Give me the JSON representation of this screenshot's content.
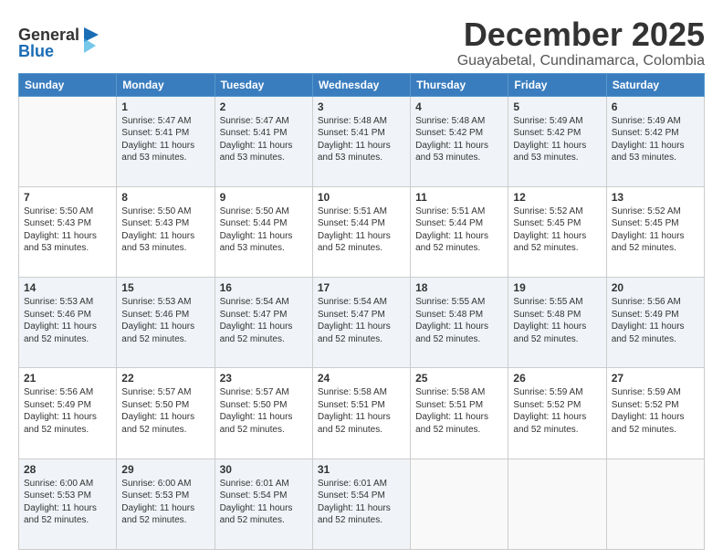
{
  "logo": {
    "line1": "General",
    "line2": "Blue"
  },
  "title": "December 2025",
  "location": "Guayabetal, Cundinamarca, Colombia",
  "headers": [
    "Sunday",
    "Monday",
    "Tuesday",
    "Wednesday",
    "Thursday",
    "Friday",
    "Saturday"
  ],
  "weeks": [
    [
      {
        "day": "",
        "info": ""
      },
      {
        "day": "1",
        "info": "Sunrise: 5:47 AM\nSunset: 5:41 PM\nDaylight: 11 hours\nand 53 minutes."
      },
      {
        "day": "2",
        "info": "Sunrise: 5:47 AM\nSunset: 5:41 PM\nDaylight: 11 hours\nand 53 minutes."
      },
      {
        "day": "3",
        "info": "Sunrise: 5:48 AM\nSunset: 5:41 PM\nDaylight: 11 hours\nand 53 minutes."
      },
      {
        "day": "4",
        "info": "Sunrise: 5:48 AM\nSunset: 5:42 PM\nDaylight: 11 hours\nand 53 minutes."
      },
      {
        "day": "5",
        "info": "Sunrise: 5:49 AM\nSunset: 5:42 PM\nDaylight: 11 hours\nand 53 minutes."
      },
      {
        "day": "6",
        "info": "Sunrise: 5:49 AM\nSunset: 5:42 PM\nDaylight: 11 hours\nand 53 minutes."
      }
    ],
    [
      {
        "day": "7",
        "info": "Sunrise: 5:50 AM\nSunset: 5:43 PM\nDaylight: 11 hours\nand 53 minutes."
      },
      {
        "day": "8",
        "info": "Sunrise: 5:50 AM\nSunset: 5:43 PM\nDaylight: 11 hours\nand 53 minutes."
      },
      {
        "day": "9",
        "info": "Sunrise: 5:50 AM\nSunset: 5:44 PM\nDaylight: 11 hours\nand 53 minutes."
      },
      {
        "day": "10",
        "info": "Sunrise: 5:51 AM\nSunset: 5:44 PM\nDaylight: 11 hours\nand 52 minutes."
      },
      {
        "day": "11",
        "info": "Sunrise: 5:51 AM\nSunset: 5:44 PM\nDaylight: 11 hours\nand 52 minutes."
      },
      {
        "day": "12",
        "info": "Sunrise: 5:52 AM\nSunset: 5:45 PM\nDaylight: 11 hours\nand 52 minutes."
      },
      {
        "day": "13",
        "info": "Sunrise: 5:52 AM\nSunset: 5:45 PM\nDaylight: 11 hours\nand 52 minutes."
      }
    ],
    [
      {
        "day": "14",
        "info": "Sunrise: 5:53 AM\nSunset: 5:46 PM\nDaylight: 11 hours\nand 52 minutes."
      },
      {
        "day": "15",
        "info": "Sunrise: 5:53 AM\nSunset: 5:46 PM\nDaylight: 11 hours\nand 52 minutes."
      },
      {
        "day": "16",
        "info": "Sunrise: 5:54 AM\nSunset: 5:47 PM\nDaylight: 11 hours\nand 52 minutes."
      },
      {
        "day": "17",
        "info": "Sunrise: 5:54 AM\nSunset: 5:47 PM\nDaylight: 11 hours\nand 52 minutes."
      },
      {
        "day": "18",
        "info": "Sunrise: 5:55 AM\nSunset: 5:48 PM\nDaylight: 11 hours\nand 52 minutes."
      },
      {
        "day": "19",
        "info": "Sunrise: 5:55 AM\nSunset: 5:48 PM\nDaylight: 11 hours\nand 52 minutes."
      },
      {
        "day": "20",
        "info": "Sunrise: 5:56 AM\nSunset: 5:49 PM\nDaylight: 11 hours\nand 52 minutes."
      }
    ],
    [
      {
        "day": "21",
        "info": "Sunrise: 5:56 AM\nSunset: 5:49 PM\nDaylight: 11 hours\nand 52 minutes."
      },
      {
        "day": "22",
        "info": "Sunrise: 5:57 AM\nSunset: 5:50 PM\nDaylight: 11 hours\nand 52 minutes."
      },
      {
        "day": "23",
        "info": "Sunrise: 5:57 AM\nSunset: 5:50 PM\nDaylight: 11 hours\nand 52 minutes."
      },
      {
        "day": "24",
        "info": "Sunrise: 5:58 AM\nSunset: 5:51 PM\nDaylight: 11 hours\nand 52 minutes."
      },
      {
        "day": "25",
        "info": "Sunrise: 5:58 AM\nSunset: 5:51 PM\nDaylight: 11 hours\nand 52 minutes."
      },
      {
        "day": "26",
        "info": "Sunrise: 5:59 AM\nSunset: 5:52 PM\nDaylight: 11 hours\nand 52 minutes."
      },
      {
        "day": "27",
        "info": "Sunrise: 5:59 AM\nSunset: 5:52 PM\nDaylight: 11 hours\nand 52 minutes."
      }
    ],
    [
      {
        "day": "28",
        "info": "Sunrise: 6:00 AM\nSunset: 5:53 PM\nDaylight: 11 hours\nand 52 minutes."
      },
      {
        "day": "29",
        "info": "Sunrise: 6:00 AM\nSunset: 5:53 PM\nDaylight: 11 hours\nand 52 minutes."
      },
      {
        "day": "30",
        "info": "Sunrise: 6:01 AM\nSunset: 5:54 PM\nDaylight: 11 hours\nand 52 minutes."
      },
      {
        "day": "31",
        "info": "Sunrise: 6:01 AM\nSunset: 5:54 PM\nDaylight: 11 hours\nand 52 minutes."
      },
      {
        "day": "",
        "info": ""
      },
      {
        "day": "",
        "info": ""
      },
      {
        "day": "",
        "info": ""
      }
    ]
  ]
}
